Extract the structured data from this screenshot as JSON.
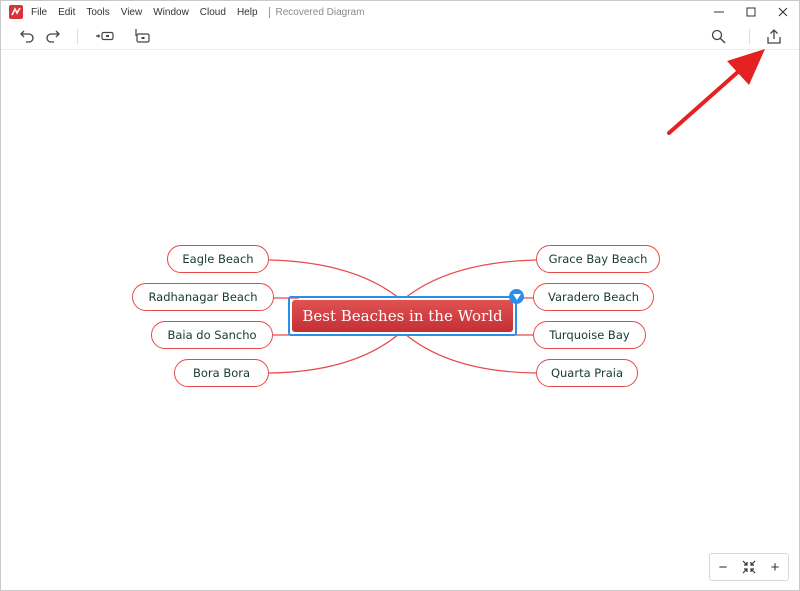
{
  "menu": {
    "items": [
      "File",
      "Edit",
      "Tools",
      "View",
      "Window",
      "Cloud",
      "Help"
    ],
    "document_title": "Recovered Diagram"
  },
  "toolbar": {
    "icons": [
      "undo-icon",
      "redo-icon",
      "insert-subtopic-icon",
      "insert-topic-icon",
      "search-icon",
      "export-icon"
    ]
  },
  "mindmap": {
    "central_topic": "Best Beaches in the World",
    "left_topics": [
      "Eagle Beach",
      "Radhanagar Beach",
      "Baia do Sancho",
      "Bora Bora"
    ],
    "right_topics": [
      "Grace Bay Beach",
      "Varadero Beach",
      "Turquoise Bay",
      "Quarta Praia"
    ]
  },
  "zoom": {
    "minus": "−",
    "plus": "+"
  },
  "colors": {
    "central_fill": "#d23d40",
    "topic_border": "#e84a4a",
    "selection": "#2b8ee8",
    "annotation_arrow": "#e52222"
  }
}
